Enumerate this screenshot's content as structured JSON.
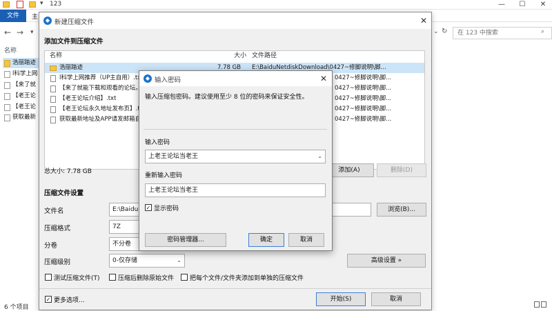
{
  "explorer": {
    "title": "123",
    "ribbon_file": "文件",
    "ribbon_tab_home": "主",
    "search_placeholder": "在 123 中搜索",
    "column_name": "名称",
    "items": [
      "浩丽踏迹",
      "l科学上网",
      "【来了就",
      "【老王论",
      "【老王论",
      "获取最新"
    ],
    "status": "6 个项目"
  },
  "compress": {
    "title": "新建压缩文件",
    "section_files": "添加文件到压缩文件",
    "headers": {
      "name": "名称",
      "size": "大小",
      "path": "文件路径"
    },
    "files": [
      {
        "name": "浩丽踏迹",
        "size": "7.78 GB",
        "path": "E:\\BaiduNetdiskDownload\\0427~修脚说明\\脚...",
        "folder": true,
        "selected": true
      },
      {
        "name": "l科学上网推荐（UP主自用）.txt",
        "size": "",
        "path": "0427~修脚说明\\脚...",
        "folder": false,
        "selected": false
      },
      {
        "name": "【来了就能下载和观看的论坛。",
        "size": "",
        "path": "0427~修脚说明\\脚...",
        "folder": false,
        "selected": false
      },
      {
        "name": "【老王论坛介绍】.txt",
        "size": "",
        "path": "0427~修脚说明\\脚...",
        "folder": false,
        "selected": false
      },
      {
        "name": "【老王论坛永久地址发布页】.t",
        "size": "",
        "path": "0427~修脚说明\\脚...",
        "folder": false,
        "selected": false
      },
      {
        "name": "获取最新地址及APP请发邮箱自",
        "size": "",
        "path": "0427~修脚说明\\脚...",
        "folder": false,
        "selected": false
      }
    ],
    "total_size": "总大小: 7.78 GB",
    "add_button": "添加(A)",
    "delete_button": "删除(D)",
    "section_settings": "压缩文件设置",
    "filename_label": "文件名",
    "filename_value": "E:\\BaiduN",
    "browse_button": "浏览(B)...",
    "format_label": "压缩格式",
    "format_value": "7Z",
    "volume_label": "分卷",
    "volume_value": "不分卷",
    "level_label": "压缩级别",
    "level_value": "0-仅存储",
    "advanced_button": "高级设置 »",
    "test_label": "测试压缩文件(T)",
    "delete_after_label": "压缩后删除原始文件",
    "each_file_label": "把每个文件/文件夹添加到单独的压缩文件",
    "more_options_label": "更多选项...",
    "start_button": "开始(S)",
    "cancel_button": "取消"
  },
  "password": {
    "title": "输入密码",
    "hint": "输入压缩包密码。建议使用至少 8 位的密码来保证安全性。",
    "enter_label": "输入密码",
    "enter_value": "上老王论坛当老王",
    "reenter_label": "重新输入密码",
    "reenter_value": "上老王论坛当老王",
    "show_label": "显示密码",
    "manager_button": "密码管理器...",
    "ok_button": "确定",
    "cancel_button": "取消"
  }
}
